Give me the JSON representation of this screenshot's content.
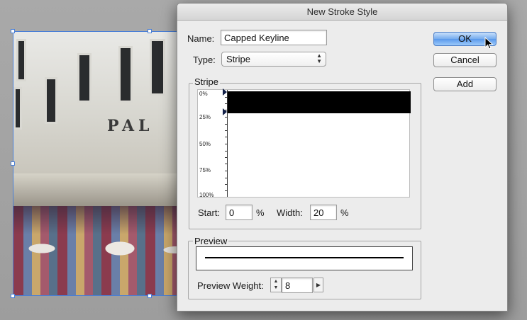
{
  "dialog": {
    "title": "New Stroke Style",
    "name_label": "Name:",
    "name_value": "Capped Keyline",
    "type_label": "Type:",
    "type_value": "Stripe",
    "buttons": {
      "ok": "OK",
      "cancel": "Cancel",
      "add": "Add"
    },
    "stripe_group": {
      "title": "Stripe",
      "ruler_labels": [
        "0%",
        "25%",
        "50%",
        "75%",
        "100%"
      ],
      "start_label": "Start:",
      "start_value": "0",
      "start_unit": "%",
      "width_label": "Width:",
      "width_value": "20",
      "width_unit": "%"
    },
    "preview_group": {
      "title": "Preview",
      "weight_label": "Preview Weight:",
      "weight_value": "8"
    }
  },
  "background": {
    "sign_text": "PAL"
  },
  "colors": {
    "accent": "#5a99ec",
    "selection": "#4a7fd6",
    "stripe": "#000000"
  },
  "icons": [
    "up-down-arrows-icon",
    "triangle-marker-icon",
    "stepper-arrows-icon",
    "right-arrow-icon",
    "mouse-pointer-icon"
  ]
}
